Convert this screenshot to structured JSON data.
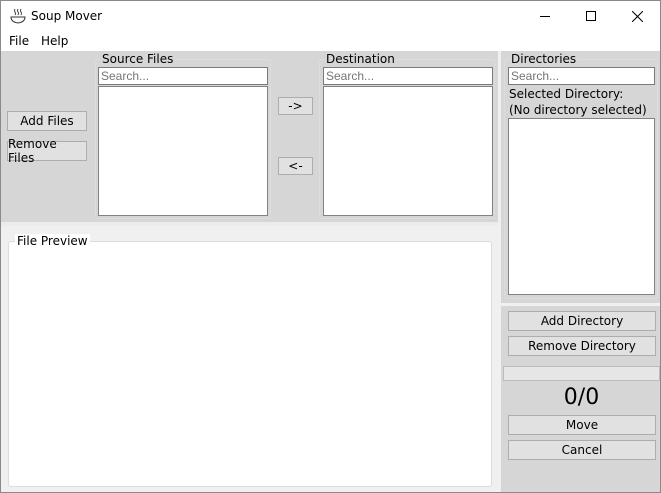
{
  "window": {
    "title": "Soup Mover"
  },
  "menu": [
    "File",
    "Help"
  ],
  "left_buttons": {
    "add_files": "Add Files",
    "remove_files": "Remove Files"
  },
  "source": {
    "label": "Source Files",
    "search_placeholder": "Search..."
  },
  "destination": {
    "label": "Destination",
    "search_placeholder": "Search..."
  },
  "transfer": {
    "right": "->",
    "left": "<-"
  },
  "directories": {
    "label": "Directories",
    "search_placeholder": "Search...",
    "selected_label": "Selected Directory:",
    "selected_value": "(No directory selected)",
    "add": "Add Directory",
    "remove": "Remove Directory"
  },
  "preview": {
    "label": "File Preview"
  },
  "progress": {
    "value": 0,
    "counter": "0/0"
  },
  "actions": {
    "move": "Move",
    "cancel": "Cancel"
  }
}
